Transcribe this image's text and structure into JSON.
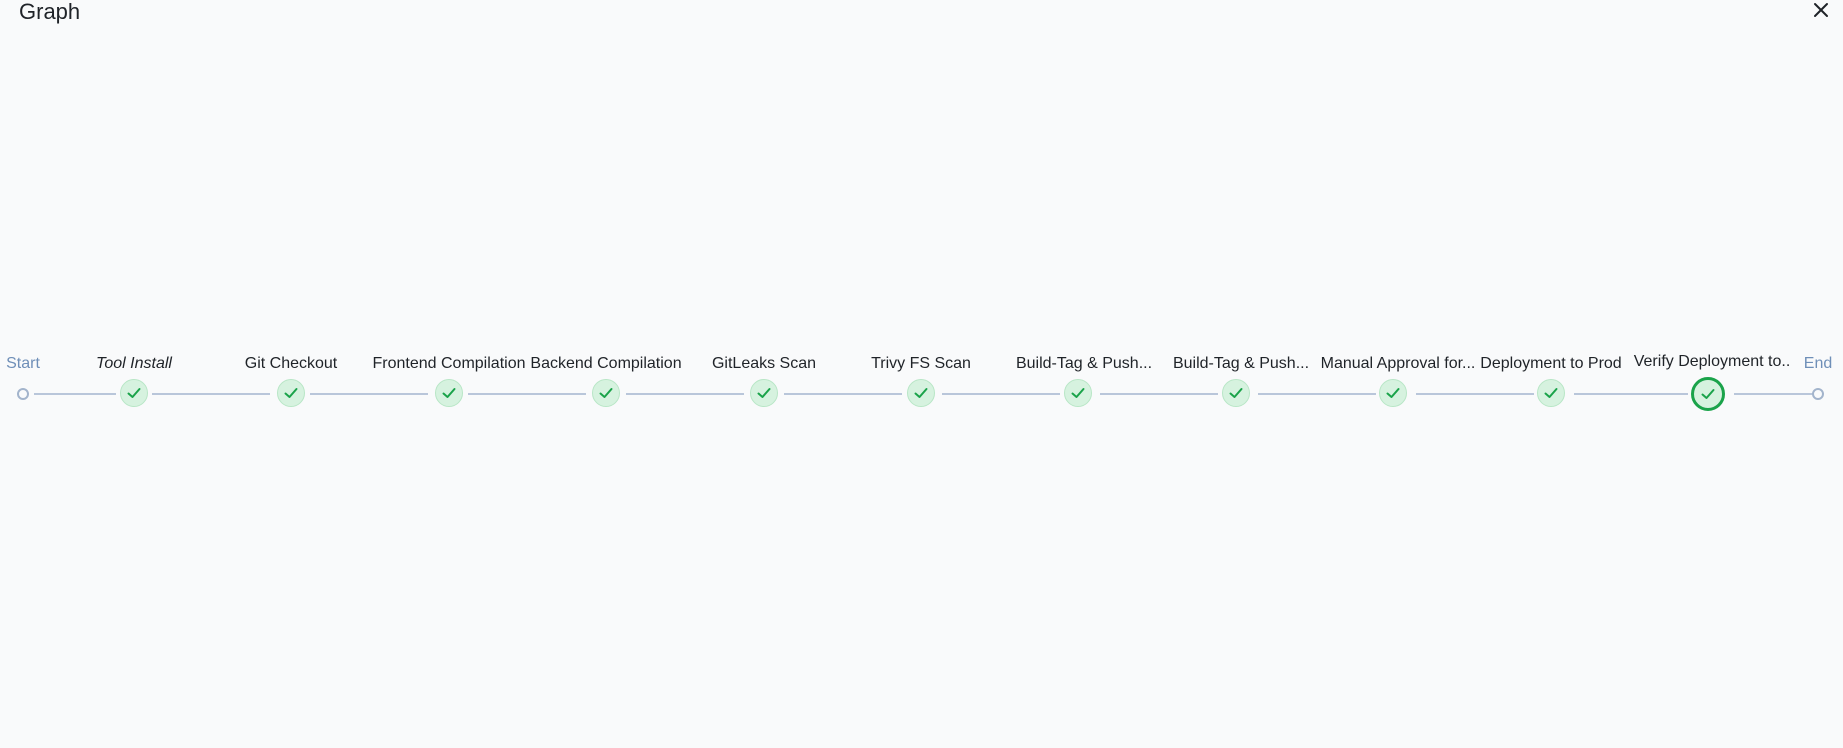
{
  "dialog": {
    "title": "Graph"
  },
  "graph": {
    "start_label": "Start",
    "end_label": "End",
    "stages": [
      {
        "label": "Tool Install",
        "status": "success"
      },
      {
        "label": "Git Checkout",
        "status": "success"
      },
      {
        "label": "Frontend Compilation",
        "status": "success"
      },
      {
        "label": "Backend Compilation",
        "status": "success"
      },
      {
        "label": "GitLeaks Scan",
        "status": "success"
      },
      {
        "label": "Trivy FS Scan",
        "status": "success"
      },
      {
        "label": "Build-Tag & Push...",
        "status": "success"
      },
      {
        "label": "Build-Tag & Push...",
        "status": "success"
      },
      {
        "label": "Manual Approval for...",
        "status": "success"
      },
      {
        "label": "Deployment to Prod",
        "status": "success"
      },
      {
        "label": "Verify Deployment to..",
        "status": "success",
        "selected": true
      }
    ]
  },
  "icons": {
    "close": "close-icon",
    "stage_status": "check-icon"
  },
  "colors": {
    "success": "#1aa34a",
    "success_bg": "#d6f2df",
    "connector": "#b9c6da",
    "terminal_label": "#6f8fb8"
  }
}
